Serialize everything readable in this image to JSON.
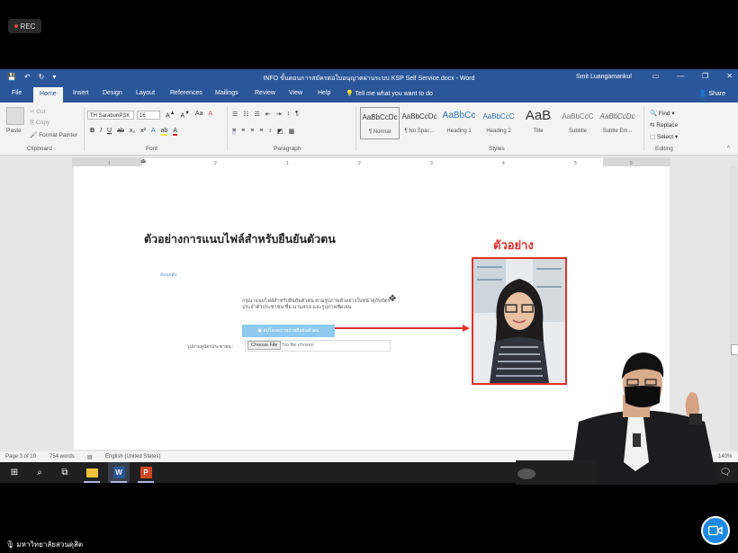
{
  "recording": {
    "label": "REC"
  },
  "word": {
    "doc_title": "INFO ขั้นตอนการสมัครต่อใบอนุญาตผ่านระบบ KSP Self Service.docx  -  Word",
    "user_name": "Smit Luangamankul",
    "tabs": [
      "File",
      "Home",
      "Insert",
      "Design",
      "Layout",
      "References",
      "Mailings",
      "Review",
      "View",
      "Help"
    ],
    "active_tab": "Home",
    "tell_me": "Tell me what you want to do",
    "share": "Share",
    "clipboard": {
      "paste": "Paste",
      "cut": "Cut",
      "copy": "Copy",
      "format_painter": "Format Painter",
      "label": "Clipboard"
    },
    "font": {
      "name": "TH SarabunPSK",
      "size": "16",
      "label": "Font"
    },
    "paragraph_label": "Paragraph",
    "styles_label": "Styles",
    "styles": [
      {
        "preview": "AaBbCcDc",
        "name": "¶ Normal"
      },
      {
        "preview": "AaBbCcDc",
        "name": "¶ No Spac..."
      },
      {
        "preview": "AaBbCc",
        "name": "Heading 1"
      },
      {
        "preview": "AaBbCcC",
        "name": "Heading 2"
      },
      {
        "preview": "AaB",
        "name": "Title"
      },
      {
        "preview": "AaBbCcC",
        "name": "Subtitle"
      },
      {
        "preview": "AaBbCcDc",
        "name": "Subtle Em..."
      }
    ],
    "editing": {
      "find": "Find",
      "replace": "Replace",
      "select": "Select",
      "label": "Editing"
    },
    "ruler_ticks": [
      "1",
      "2",
      "1",
      "2",
      "3",
      "4",
      "5",
      "6",
      "7"
    ],
    "status": {
      "page": "Page 3 of 10",
      "words": "754 words",
      "language": "English (United States)",
      "zoom": "140%"
    }
  },
  "document": {
    "heading": "ตัวอย่างการแนบไฟล์สำหรับยืนยันตัวตน",
    "sample_label": "ตัวอย่าง",
    "back_link": "ย้อนกลับ",
    "instructions": "กรุณาแนบไฟล์สำหรับยืนยันตัวตน ตามรูปภาพตัวอย่างใบหน้าคู่กับบัตรประจำตัวประชาชน ชื่อ-นามสกุล และรูปภาพชัดเจน",
    "upload_button": "อัปโหลดภาพถ่ายยืนยันตัวตน",
    "file_label": "รูปถ่ายคู่บัตรประชาชน :",
    "choose_file": "Choose File",
    "no_file": "No file chosen"
  },
  "participant": {
    "name": "มหาวิทยาลัยสวนดุสิต"
  }
}
